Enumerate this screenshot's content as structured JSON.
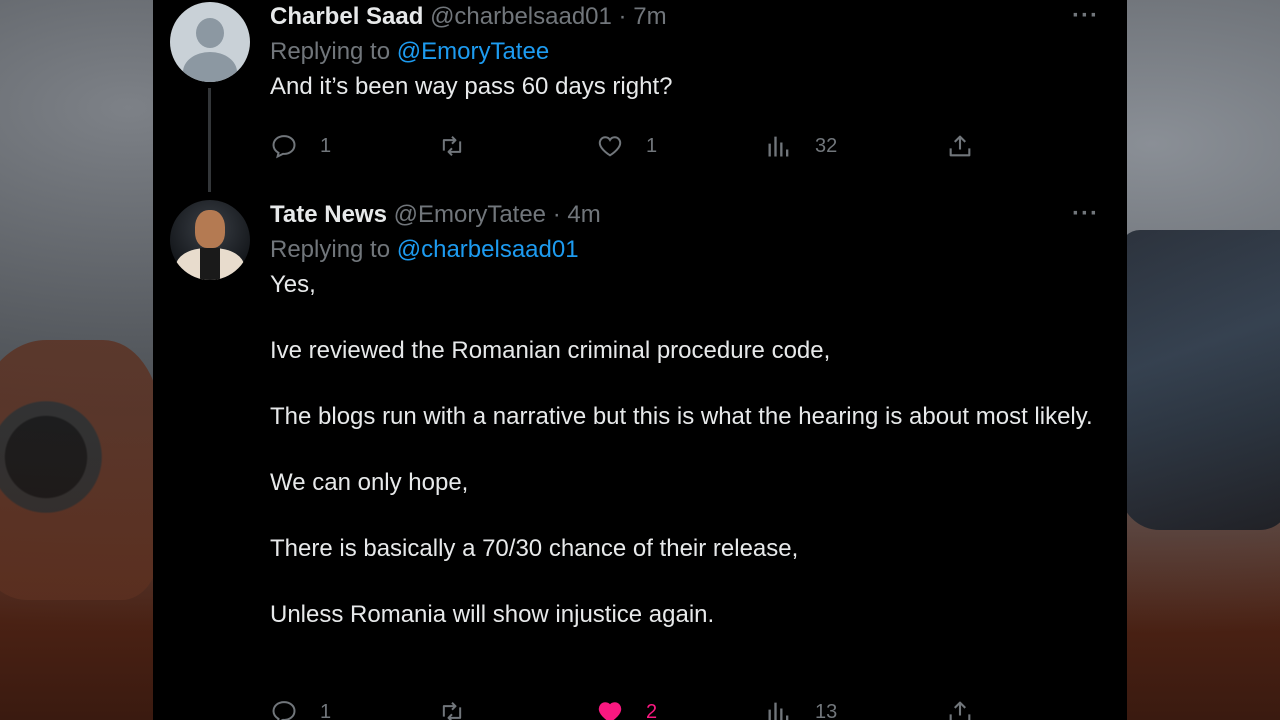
{
  "tweets": [
    {
      "name": "Charbel Saad",
      "handle": "@charbelsaad01",
      "time": "7m",
      "replying_label": "Replying to ",
      "replying_to": "@EmoryTatee",
      "text": [
        "And it’s been way pass 60 days right?"
      ],
      "stats": {
        "replies": "1",
        "retweets": "",
        "likes": "1",
        "views": "32"
      },
      "liked": false
    },
    {
      "name": "Tate News",
      "handle": "@EmoryTatee",
      "time": "4m",
      "replying_label": "Replying to ",
      "replying_to": "@charbelsaad01",
      "text": [
        "Yes,",
        "Ive reviewed the Romanian criminal procedure code,",
        "The blogs run with a narrative but this is what the hearing is about most likely.",
        "We can only hope,",
        "There is basically a 70/30 chance of their release,",
        "Unless Romania will show injustice again."
      ],
      "stats": {
        "replies": "1",
        "retweets": "",
        "likes": "2",
        "views": "13"
      },
      "liked": true
    }
  ],
  "icons": {
    "reply": "reply-icon",
    "retweet": "retweet-icon",
    "like": "heart-icon",
    "views": "views-icon",
    "share": "share-icon",
    "more": "more-icon"
  },
  "colors": {
    "background": "#000000",
    "text": "#e7e9ea",
    "secondary": "#71767b",
    "link": "#1d9bf0",
    "like": "#f91880"
  },
  "more_glyph": "···",
  "separator": " · "
}
